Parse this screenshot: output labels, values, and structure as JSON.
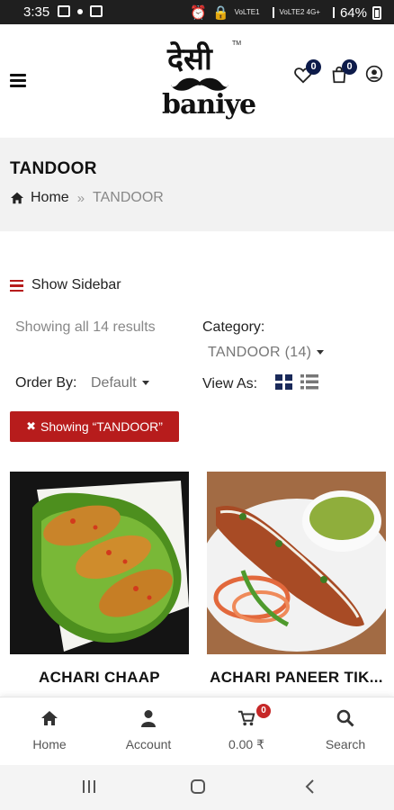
{
  "status_bar": {
    "time": "3:35",
    "net1": "VoLTE1",
    "net2": "VoLTE2 4G+",
    "battery": "64%"
  },
  "header": {
    "logo_hindi": "देसी",
    "logo_latin": "baniye",
    "logo_tm": "TM",
    "wishlist_count": "0",
    "cart_count": "0"
  },
  "page": {
    "title": "TANDOOR",
    "breadcrumb_home": "Home",
    "breadcrumb_sep": "»",
    "breadcrumb_current": "TANDOOR"
  },
  "filters": {
    "show_sidebar": "Show Sidebar",
    "results": "Showing all 14 results",
    "category_label": "Category:",
    "category_value": "TANDOOR (14)",
    "order_label": "Order By:",
    "order_value": "Default",
    "view_label": "View As:",
    "active_filter": "Showing “TANDOOR”"
  },
  "products": [
    {
      "name": "ACHARI CHAAP"
    },
    {
      "name": "ACHARI PANEER TIK..."
    }
  ],
  "bottom_nav": {
    "home": "Home",
    "account": "Account",
    "cart_total": "0.00 ₹",
    "cart_badge": "0",
    "search": "Search"
  },
  "colors": {
    "accent_red": "#b71c1c",
    "badge_navy": "#0d1b4a",
    "band_gray": "#f2f2f2"
  }
}
